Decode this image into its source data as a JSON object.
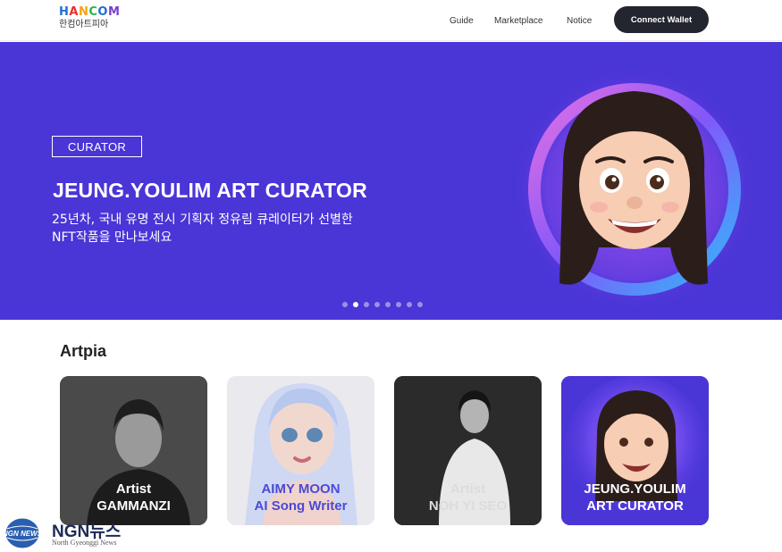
{
  "header": {
    "logo_word": "HANCOM",
    "logo_sub": "한컴아트피아",
    "nav": [
      "Guide",
      "Marketplace",
      "Notice"
    ],
    "connect_wallet": "Connect Wallet"
  },
  "hero": {
    "tag": "CURATOR",
    "title": "JEUNG.YOULIM ART CURATOR",
    "desc_line1": "25년차, 국내 유명 전시 기획자 정유림 큐레이터가 선별한",
    "desc_line2": "NFT작품을 만나보세요",
    "bg_color": "#4a35d6",
    "carousel_total": 8,
    "carousel_active": 2
  },
  "section": {
    "title": "Artpia",
    "cards": [
      {
        "line1": "Artist",
        "line2": "GAMMANZI"
      },
      {
        "line1": "AIMY MOON",
        "line2": "AI Song Writer"
      },
      {
        "line1": "Artist",
        "line2": "NOH YI SEO"
      },
      {
        "line1": "JEUNG.YOULIM",
        "line2": "ART CURATOR"
      }
    ]
  },
  "watermark": {
    "name": "NGN뉴스",
    "sub": "North Gyeonggi News",
    "globe_text": "NGN NEWS"
  }
}
